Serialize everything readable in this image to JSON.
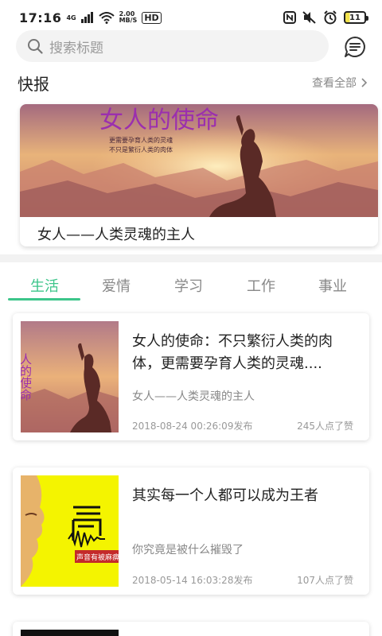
{
  "statusbar": {
    "time": "17:16",
    "net_gen": "4G",
    "net_speed_top": "2.00",
    "net_speed_bottom": "MB/S",
    "hd": "HD",
    "battery": "11"
  },
  "search": {
    "placeholder": "搜索标题"
  },
  "kuaibao": {
    "title": "快报",
    "more": "查看全部",
    "banner_caption": "女人——人类灵魂的主人",
    "banner_art_title": "女人的使命",
    "banner_art_sub1": "更需要孕育人类的灵魂",
    "banner_art_sub2": "不只是繁衍人类的肉体"
  },
  "tabs": [
    {
      "label": "生活",
      "active": true
    },
    {
      "label": "爱情",
      "active": false
    },
    {
      "label": "学习",
      "active": false
    },
    {
      "label": "工作",
      "active": false
    },
    {
      "label": "事业",
      "active": false
    }
  ],
  "articles": [
    {
      "title": "女人的使命：不只繁衍人类的肉体，更需要孕育人类的灵魂....",
      "subtitle": "女人——人类灵魂的主人",
      "date": "2018-08-24 00:26:09发布",
      "likes": "245人点了赞",
      "thumb_text": "人的使命"
    },
    {
      "title": "其实每一个人都可以成为王者",
      "subtitle": "你究竟是被什么摧毁了",
      "date": "2018-05-14 16:03:28发布",
      "likes": "107人点了赞",
      "thumb_text": "声音有被麻痹"
    }
  ],
  "colors": {
    "accent": "#3cc58a",
    "thumb2_bg": "#f4f400"
  }
}
